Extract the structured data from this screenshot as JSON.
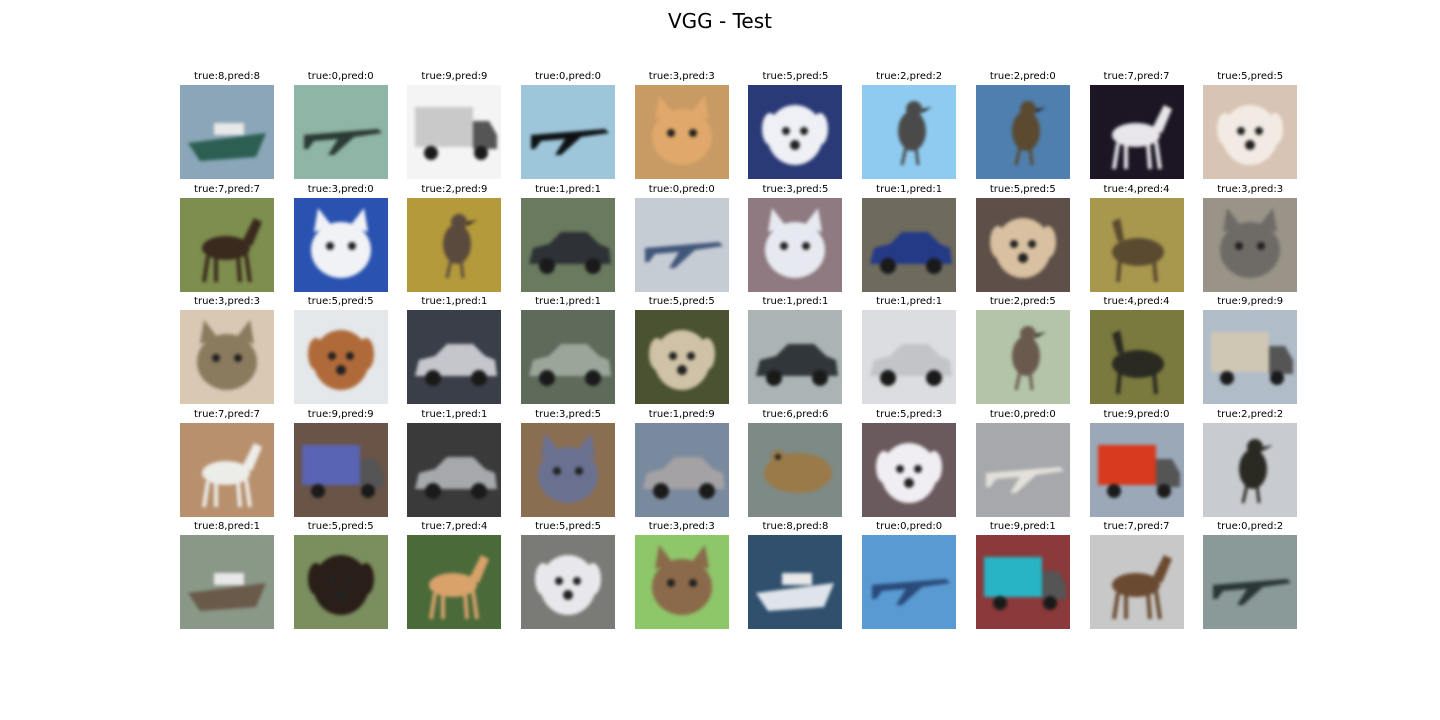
{
  "title": "VGG - Test",
  "samples": [
    {
      "label": "true:8,pred:8",
      "icon": "ship",
      "bg": "#8aa6b8",
      "obj": "#2c5f52"
    },
    {
      "label": "true:0,pred:0",
      "icon": "airplane",
      "bg": "#8fb5a6",
      "obj": "#2a3a34"
    },
    {
      "label": "true:9,pred:9",
      "icon": "truck",
      "bg": "#f4f4f4",
      "obj": "#c9c9c9"
    },
    {
      "label": "true:0,pred:0",
      "icon": "airplane",
      "bg": "#9ec6da",
      "obj": "#0d1114"
    },
    {
      "label": "true:3,pred:3",
      "icon": "cat",
      "bg": "#c89a64",
      "obj": "#e0a86a"
    },
    {
      "label": "true:5,pred:5",
      "icon": "dog",
      "bg": "#2a3a76",
      "obj": "#eef0f5"
    },
    {
      "label": "true:2,pred:2",
      "icon": "bird",
      "bg": "#8fcbf0",
      "obj": "#4a4a4a"
    },
    {
      "label": "true:2,pred:0",
      "icon": "bird",
      "bg": "#4f7fae",
      "obj": "#5b4a30"
    },
    {
      "label": "true:7,pred:7",
      "icon": "horse",
      "bg": "#1c1624",
      "obj": "#e8e6ea"
    },
    {
      "label": "true:5,pred:5",
      "icon": "dog",
      "bg": "#d8c4b4",
      "obj": "#f2ebe3"
    },
    {
      "label": "true:7,pred:7",
      "icon": "horse",
      "bg": "#7e8e4e",
      "obj": "#3a2a1e"
    },
    {
      "label": "true:3,pred:0",
      "icon": "cat",
      "bg": "#2a52b0",
      "obj": "#f0f2f6"
    },
    {
      "label": "true:2,pred:9",
      "icon": "bird",
      "bg": "#b49a3a",
      "obj": "#5a4a3e"
    },
    {
      "label": "true:1,pred:1",
      "icon": "automobile",
      "bg": "#6a7a5e",
      "obj": "#2e3236"
    },
    {
      "label": "true:0,pred:0",
      "icon": "airplane",
      "bg": "#c6ccd4",
      "obj": "#40567a"
    },
    {
      "label": "true:3,pred:5",
      "icon": "cat",
      "bg": "#8e7a80",
      "obj": "#e6eaf0"
    },
    {
      "label": "true:1,pred:1",
      "icon": "automobile",
      "bg": "#6e6a5e",
      "obj": "#243a86"
    },
    {
      "label": "true:5,pred:5",
      "icon": "dog",
      "bg": "#5e5048",
      "obj": "#d8c0a0"
    },
    {
      "label": "true:4,pred:4",
      "icon": "deer",
      "bg": "#a8984e",
      "obj": "#5a4a30"
    },
    {
      "label": "true:3,pred:3",
      "icon": "cat",
      "bg": "#9a9488",
      "obj": "#6e6a66"
    },
    {
      "label": "true:3,pred:3",
      "icon": "cat",
      "bg": "#d8c8b4",
      "obj": "#8a7a5e"
    },
    {
      "label": "true:5,pred:5",
      "icon": "dog",
      "bg": "#e4e8ea",
      "obj": "#b06a3a"
    },
    {
      "label": "true:1,pred:1",
      "icon": "automobile",
      "bg": "#3a3e48",
      "obj": "#c4c6cc"
    },
    {
      "label": "true:1,pred:1",
      "icon": "automobile",
      "bg": "#5e6a5a",
      "obj": "#9aa69a"
    },
    {
      "label": "true:5,pred:5",
      "icon": "dog",
      "bg": "#4a5232",
      "obj": "#cfc2a6"
    },
    {
      "label": "true:1,pred:1",
      "icon": "automobile",
      "bg": "#aab4b4",
      "obj": "#30363a"
    },
    {
      "label": "true:1,pred:1",
      "icon": "automobile",
      "bg": "#dcdde0",
      "obj": "#c2c4c8"
    },
    {
      "label": "true:2,pred:5",
      "icon": "bird",
      "bg": "#b4c4a8",
      "obj": "#6a5a4e"
    },
    {
      "label": "true:4,pred:4",
      "icon": "deer",
      "bg": "#7a7a3e",
      "obj": "#2a2a22"
    },
    {
      "label": "true:9,pred:9",
      "icon": "truck",
      "bg": "#b0bcc8",
      "obj": "#d0c6b4"
    },
    {
      "label": "true:7,pred:7",
      "icon": "horse",
      "bg": "#b8906e",
      "obj": "#ecece8"
    },
    {
      "label": "true:9,pred:9",
      "icon": "truck",
      "bg": "#6a5448",
      "obj": "#5a64b4"
    },
    {
      "label": "true:1,pred:1",
      "icon": "automobile",
      "bg": "#3a3a3a",
      "obj": "#a6a8ac"
    },
    {
      "label": "true:3,pred:5",
      "icon": "cat",
      "bg": "#8a6e52",
      "obj": "#6a7090"
    },
    {
      "label": "true:1,pred:9",
      "icon": "automobile",
      "bg": "#7a8a9e",
      "obj": "#a4a2a4"
    },
    {
      "label": "true:6,pred:6",
      "icon": "frog",
      "bg": "#7e8a86",
      "obj": "#9a7a48"
    },
    {
      "label": "true:5,pred:3",
      "icon": "dog",
      "bg": "#6a5a5e",
      "obj": "#f0eef2"
    },
    {
      "label": "true:0,pred:0",
      "icon": "airplane",
      "bg": "#a6a8ac",
      "obj": "#e2e0d8"
    },
    {
      "label": "true:9,pred:0",
      "icon": "truck",
      "bg": "#9aa8b8",
      "obj": "#d83a1e"
    },
    {
      "label": "true:2,pred:2",
      "icon": "bird",
      "bg": "#c8ccd0",
      "obj": "#2a2a22"
    },
    {
      "label": "true:8,pred:1",
      "icon": "ship",
      "bg": "#8a9888",
      "obj": "#6a5a4a"
    },
    {
      "label": "true:5,pred:5",
      "icon": "dog",
      "bg": "#7a8e5e",
      "obj": "#2a1e18"
    },
    {
      "label": "true:7,pred:4",
      "icon": "horse",
      "bg": "#4a6a3a",
      "obj": "#d8a26a"
    },
    {
      "label": "true:5,pred:5",
      "icon": "dog",
      "bg": "#7a7a76",
      "obj": "#e8e8ec"
    },
    {
      "label": "true:3,pred:3",
      "icon": "cat",
      "bg": "#8ec66a",
      "obj": "#8a6a4a"
    },
    {
      "label": "true:8,pred:8",
      "icon": "ship",
      "bg": "#30506e",
      "obj": "#dfe4ea"
    },
    {
      "label": "true:0,pred:0",
      "icon": "airplane",
      "bg": "#5a9ad2",
      "obj": "#2a4a7a"
    },
    {
      "label": "true:9,pred:1",
      "icon": "truck",
      "bg": "#8a3a3a",
      "obj": "#28b4c4"
    },
    {
      "label": "true:7,pred:7",
      "icon": "horse",
      "bg": "#c8c8c8",
      "obj": "#6a4a30"
    },
    {
      "label": "true:0,pred:2",
      "icon": "airplane",
      "bg": "#8a9a98",
      "obj": "#2a3636"
    }
  ]
}
